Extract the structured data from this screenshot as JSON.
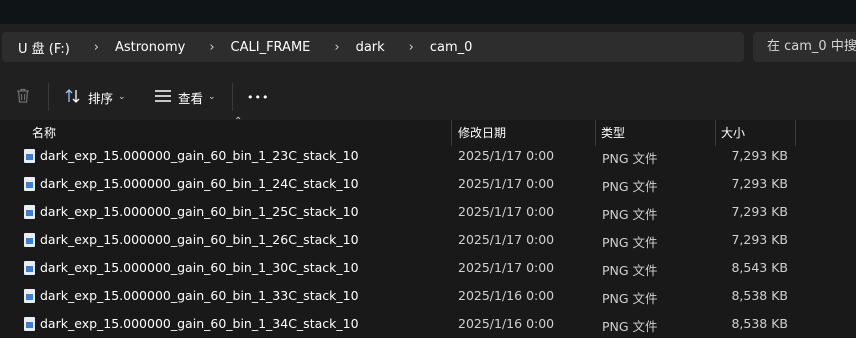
{
  "breadcrumb": [
    {
      "label": "U 盘 (F:)"
    },
    {
      "label": "Astronomy"
    },
    {
      "label": "CALI_FRAME"
    },
    {
      "label": "dark"
    },
    {
      "label": "cam_0"
    }
  ],
  "search": {
    "placeholder": "在 cam_0 中搜"
  },
  "toolbar": {
    "sort_label": "排序",
    "view_label": "查看",
    "more_label": "•••"
  },
  "columns": {
    "name": "名称",
    "modified": "修改日期",
    "type": "类型",
    "size": "大小"
  },
  "files": [
    {
      "name": "dark_exp_15.000000_gain_60_bin_1_23C_stack_10",
      "modified": "2025/1/17 0:00",
      "type": "PNG 文件",
      "size": "7,293 KB"
    },
    {
      "name": "dark_exp_15.000000_gain_60_bin_1_24C_stack_10",
      "modified": "2025/1/17 0:00",
      "type": "PNG 文件",
      "size": "7,293 KB"
    },
    {
      "name": "dark_exp_15.000000_gain_60_bin_1_25C_stack_10",
      "modified": "2025/1/17 0:00",
      "type": "PNG 文件",
      "size": "7,293 KB"
    },
    {
      "name": "dark_exp_15.000000_gain_60_bin_1_26C_stack_10",
      "modified": "2025/1/17 0:00",
      "type": "PNG 文件",
      "size": "7,293 KB"
    },
    {
      "name": "dark_exp_15.000000_gain_60_bin_1_30C_stack_10",
      "modified": "2025/1/17 0:00",
      "type": "PNG 文件",
      "size": "8,543 KB"
    },
    {
      "name": "dark_exp_15.000000_gain_60_bin_1_33C_stack_10",
      "modified": "2025/1/16 0:00",
      "type": "PNG 文件",
      "size": "8,538 KB"
    },
    {
      "name": "dark_exp_15.000000_gain_60_bin_1_34C_stack_10",
      "modified": "2025/1/16 0:00",
      "type": "PNG 文件",
      "size": "8,538 KB"
    }
  ]
}
